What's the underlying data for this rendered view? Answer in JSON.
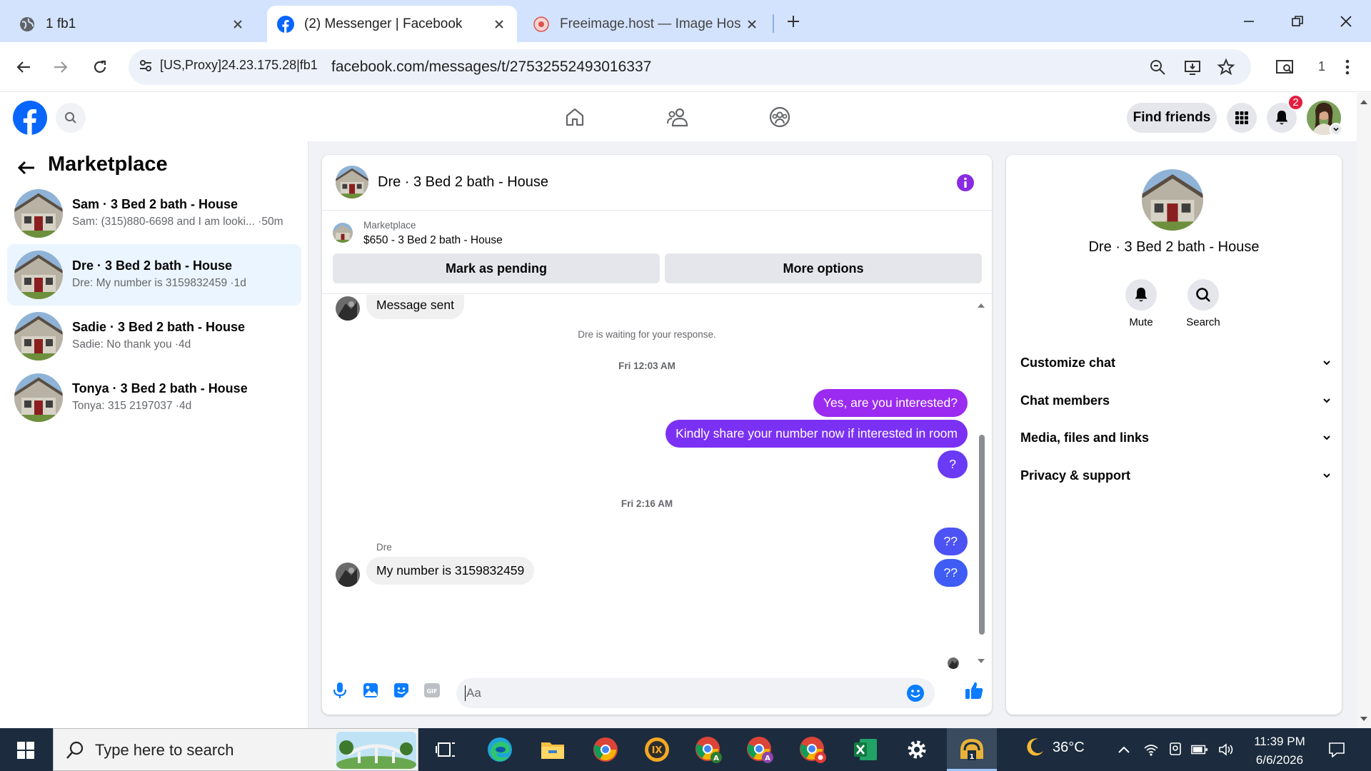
{
  "browser": {
    "tabs": [
      {
        "title": "1 fb1",
        "active": false
      },
      {
        "title": "(2) Messenger | Facebook",
        "active": true
      },
      {
        "title": "Freeimage.host — Image Hosting",
        "active": false
      }
    ],
    "site_info": "[US,Proxy]24.23.175.28|fb1",
    "url": "facebook.com/messages/t/27532552493016337",
    "extension_count": "1"
  },
  "fb_header": {
    "find_friends": "Find friends",
    "notification_count": "2",
    "nav_icons": [
      "home-icon",
      "friends-icon",
      "groups-icon"
    ]
  },
  "sidebar": {
    "title": "Marketplace",
    "conversations": [
      {
        "title": "Sam · 3 Bed 2 bath - House",
        "preview": "Sam: (315)880-6698 and I am looki... ·50m",
        "selected": false
      },
      {
        "title": "Dre · 3 Bed 2 bath - House",
        "preview": "Dre: My number is 3159832459 ·1d",
        "selected": true
      },
      {
        "title": "Sadie · 3 Bed 2 bath - House",
        "preview": "Sadie: No thank you ·4d",
        "selected": false
      },
      {
        "title": "Tonya · 3 Bed 2 bath - House",
        "preview": "Tonya: 315 2197037 ·4d",
        "selected": false
      }
    ]
  },
  "chat": {
    "title": "Dre · 3 Bed 2 bath - House",
    "listing_source": "Marketplace",
    "listing_title": "$650 - 3 Bed 2 bath - House",
    "mark_pending": "Mark as pending",
    "more_options": "More options",
    "messages": {
      "sent_note": "Message sent",
      "waiting": "Dre is waiting for your response.",
      "time1": "Fri 12:03 AM",
      "out1": "Yes, are you interested?",
      "out2": "Kindly share your number now if interested in room",
      "out3": "?",
      "time2": "Fri 2:16 AM",
      "out4": "??",
      "out5": "??",
      "sender": "Dre",
      "in1": "My number is 3159832459"
    },
    "composer_placeholder": "Aa",
    "colors": {
      "accent": "#7a2cf5",
      "out_bubble_top": "#9b2bf0",
      "out_bubble_bottom": "#3f5cf5",
      "messenger_blue": "#0a7cff"
    }
  },
  "info_panel": {
    "title": "Dre · 3 Bed 2 bath - House",
    "mute": "Mute",
    "search": "Search",
    "sections": [
      "Customize chat",
      "Chat members",
      "Media, files and links",
      "Privacy & support"
    ]
  },
  "taskbar": {
    "search_placeholder": "Type here to search",
    "temperature": "36°C",
    "time": "11:39 PM",
    "date": "6/6/2026"
  }
}
